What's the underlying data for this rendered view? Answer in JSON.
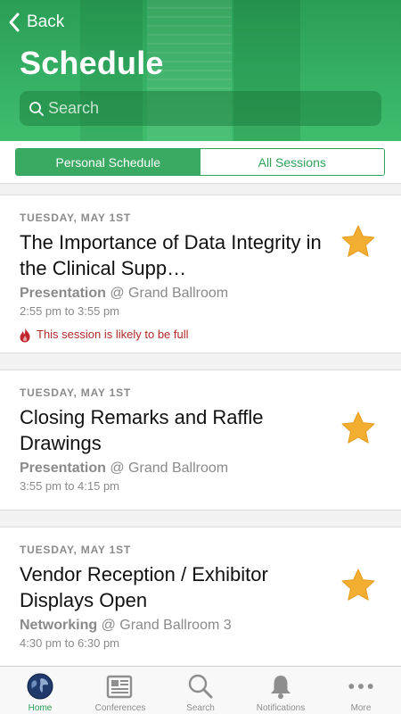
{
  "header": {
    "back_label": "Back",
    "title": "Schedule",
    "search_placeholder": "Search"
  },
  "segments": {
    "personal": "Personal Schedule",
    "all": "All Sessions",
    "active": "personal"
  },
  "sessions": [
    {
      "date": "TUESDAY, MAY 1ST",
      "title": "The Importance of Data Integrity in the Clinical Supp…",
      "type": "Presentation",
      "location": " @ Grand Ballroom",
      "time": "2:55 pm to 3:55 pm",
      "warning": "This session is likely to be full",
      "starred": true
    },
    {
      "date": "TUESDAY, MAY 1ST",
      "title": "Closing Remarks and Raffle Drawings",
      "type": "Presentation",
      "location": " @ Grand Ballroom",
      "time": "3:55 pm to 4:15 pm",
      "starred": true
    },
    {
      "date": "TUESDAY, MAY 1ST",
      "title": "Vendor Reception / Exhibitor Displays Open",
      "type": "Networking",
      "location": " @ Grand Ballroom 3",
      "time": "4:30 pm to 6:30 pm",
      "starred": true
    }
  ],
  "tabbar": [
    {
      "label": "Home",
      "icon": "globe-icon",
      "active": true
    },
    {
      "label": "Conferences",
      "icon": "newspaper-icon",
      "active": false
    },
    {
      "label": "Search",
      "icon": "search-icon",
      "active": false
    },
    {
      "label": "Notifications",
      "icon": "bell-icon",
      "active": false
    },
    {
      "label": "More",
      "icon": "more-dots-icon",
      "active": false
    }
  ],
  "colors": {
    "brand_green": "#35b064",
    "star": "#f2ae30",
    "warning": "#b12a2a"
  }
}
